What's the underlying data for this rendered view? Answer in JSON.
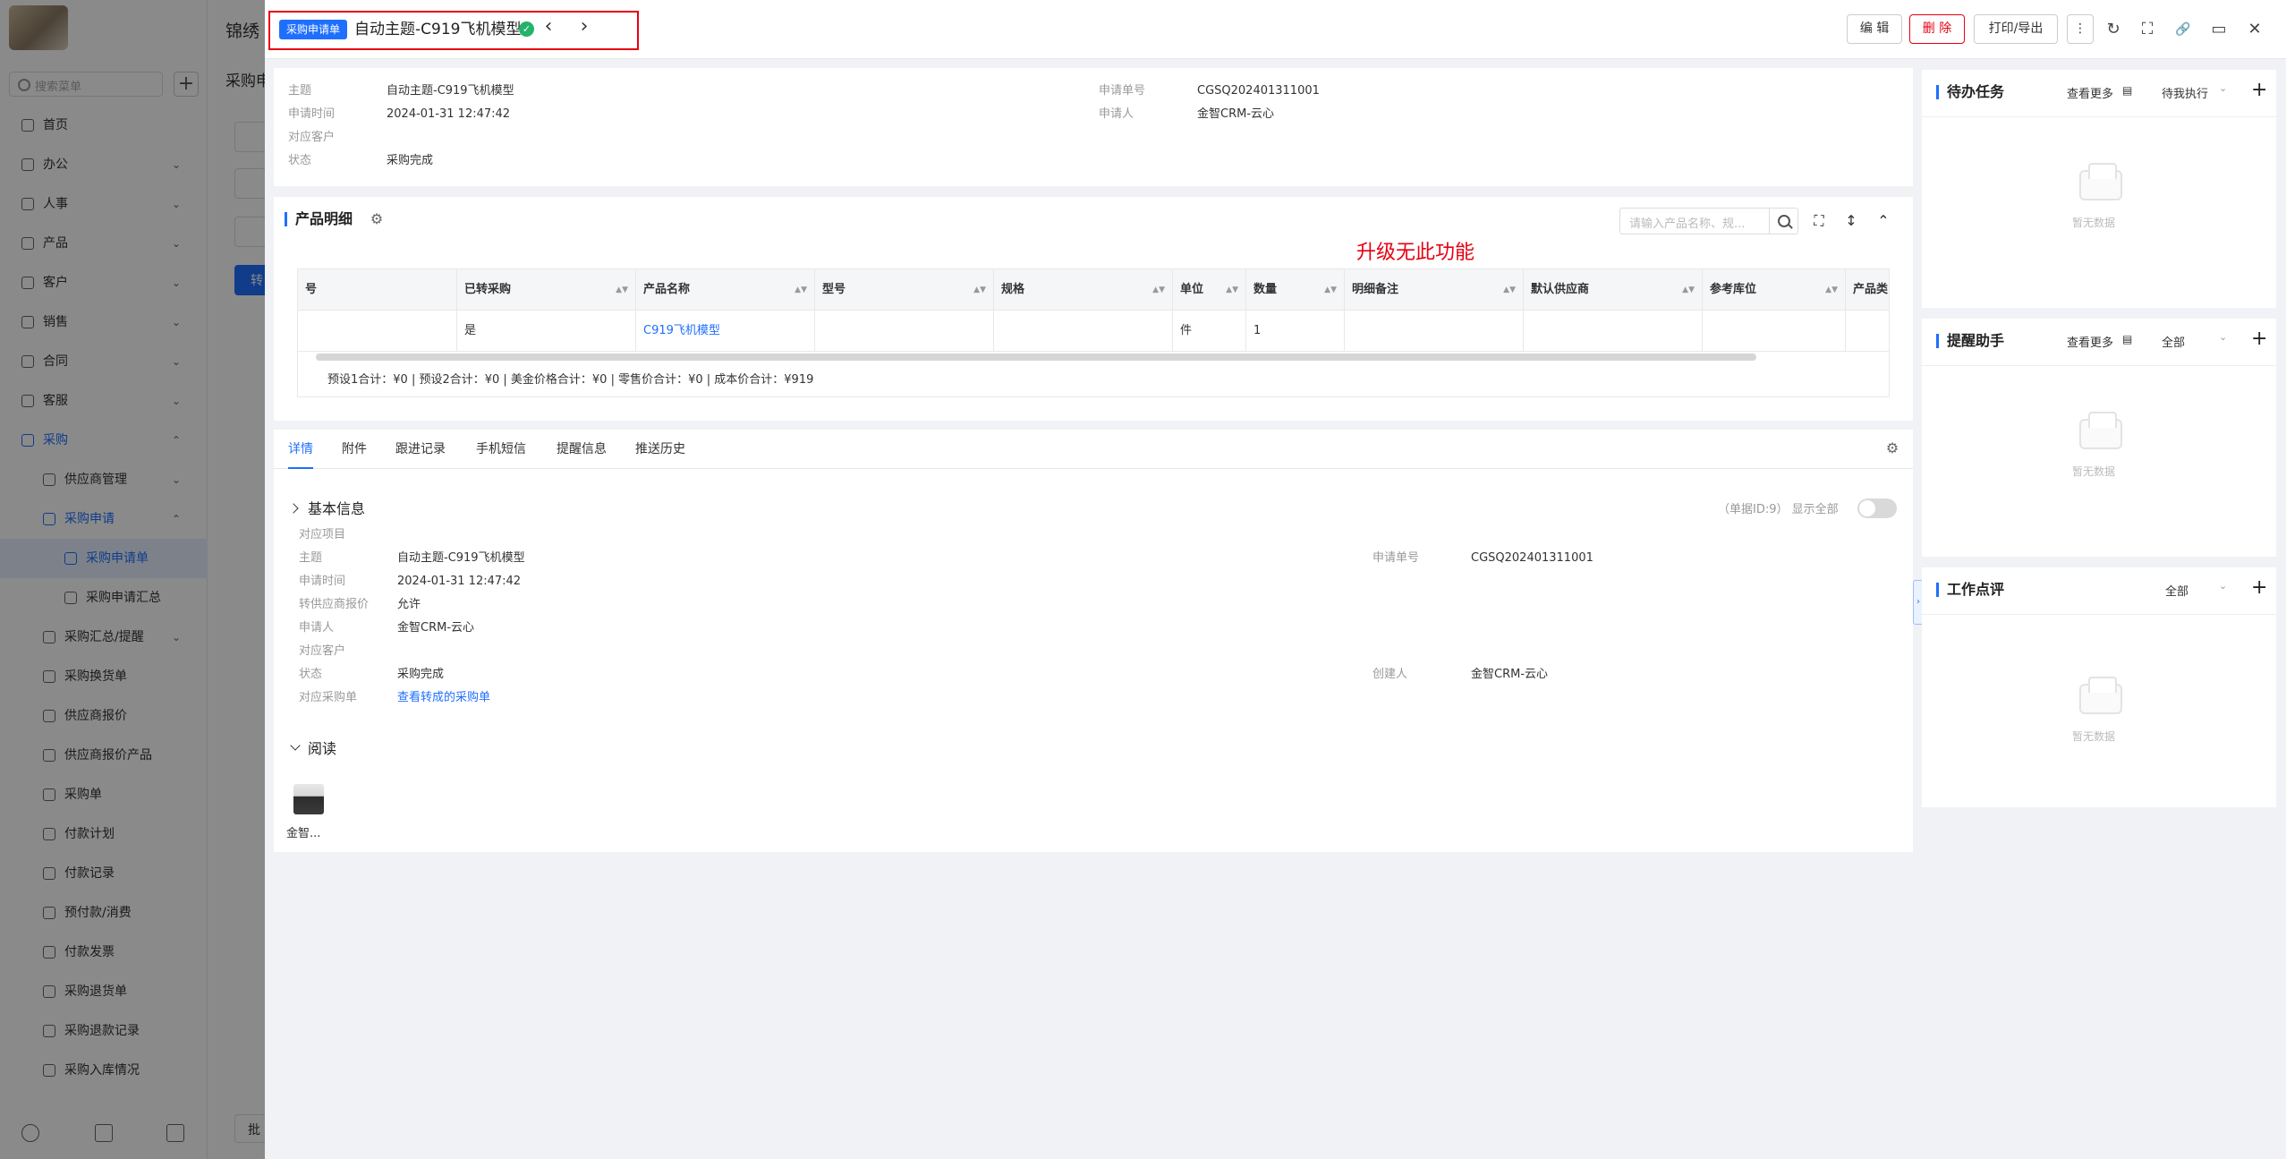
{
  "background": {
    "company": "锦绣",
    "search_placeholder": "搜索菜单",
    "page_title": "采购申",
    "primary_button": "转",
    "footer_button": "批",
    "menu": [
      {
        "label": "首页",
        "level": 0
      },
      {
        "label": "办公",
        "level": 0,
        "chev": "⌄"
      },
      {
        "label": "人事",
        "level": 0,
        "chev": "⌄"
      },
      {
        "label": "产品",
        "level": 0,
        "chev": "⌄"
      },
      {
        "label": "客户",
        "level": 0,
        "chev": "⌄"
      },
      {
        "label": "销售",
        "level": 0,
        "chev": "⌄"
      },
      {
        "label": "合同",
        "level": 0,
        "chev": "⌄"
      },
      {
        "label": "客服",
        "level": 0,
        "chev": "⌄"
      },
      {
        "label": "采购",
        "level": 0,
        "chev": "⌃",
        "active": true
      },
      {
        "label": "供应商管理",
        "level": 1,
        "chev": "⌄"
      },
      {
        "label": "采购申请",
        "level": 1,
        "chev": "⌃",
        "active": true
      },
      {
        "label": "采购申请单",
        "level": 2,
        "selected": true
      },
      {
        "label": "采购申请汇总",
        "level": 2
      },
      {
        "label": "采购汇总/提醒",
        "level": 1,
        "chev": "⌄"
      },
      {
        "label": "采购换货单",
        "level": 1
      },
      {
        "label": "供应商报价",
        "level": 1
      },
      {
        "label": "供应商报价产品",
        "level": 1
      },
      {
        "label": "采购单",
        "level": 1
      },
      {
        "label": "付款计划",
        "level": 1
      },
      {
        "label": "付款记录",
        "level": 1
      },
      {
        "label": "预付款/消费",
        "level": 1
      },
      {
        "label": "付款发票",
        "level": 1
      },
      {
        "label": "采购退货单",
        "level": 1
      },
      {
        "label": "采购退款记录",
        "level": 1
      },
      {
        "label": "采购入库情况",
        "level": 1
      }
    ]
  },
  "header": {
    "badge": "采购申请单",
    "title": "自动主题-C919飞机模型",
    "prev": "‹",
    "next": "›",
    "edit_label": "编 辑",
    "delete_label": "删 除",
    "print_label": "打印/导出",
    "more": "⋮",
    "refresh": "↻",
    "fullscreen": "⛶",
    "link": "🔗",
    "window": "▭",
    "close": "✕"
  },
  "summary": {
    "left": [
      {
        "k": "主题",
        "v": "自动主题-C919飞机模型"
      },
      {
        "k": "申请时间",
        "v": "2024-01-31 12:47:42"
      },
      {
        "k": "对应客户",
        "v": ""
      },
      {
        "k": "状态",
        "v": "采购完成"
      }
    ],
    "right": [
      {
        "k": "申请单号",
        "v": "CGSQ202401311001"
      },
      {
        "k": "申请人",
        "v": "金智CRM-云心"
      }
    ]
  },
  "products": {
    "title": "产品明细",
    "search_placeholder": "请输入产品名称、规...",
    "upgrade_note": "升级无此功能",
    "columns": [
      "号",
      "已转采购",
      "产品名称",
      "型号",
      "规格",
      "单位",
      "数量",
      "明细备注",
      "默认供应商",
      "参考库位",
      "产品类"
    ],
    "row": [
      "",
      "是",
      "C919飞机模型",
      "",
      "",
      "件",
      "1",
      "",
      "",
      "",
      ""
    ],
    "totals": "预设1合计：¥0 |   预设2合计：¥0 |   美金价格合计：¥0 |   零售价合计：¥0 |   成本价合计：¥919"
  },
  "detail": {
    "tabs": [
      "详情",
      "附件",
      "跟进记录",
      "手机短信",
      "提醒信息",
      "推送历史"
    ],
    "basic_title": "基本信息",
    "doc_meta": "（单据ID:9）   显示全部",
    "fields_left": [
      {
        "k": "对应项目",
        "v": ""
      },
      {
        "k": "主题",
        "v": "自动主题-C919飞机模型"
      },
      {
        "k": "申请时间",
        "v": "2024-01-31 12:47:42"
      },
      {
        "k": "转供应商报价",
        "v": "允许"
      },
      {
        "k": "申请人",
        "v": "金智CRM-云心"
      },
      {
        "k": "对应客户",
        "v": ""
      },
      {
        "k": "状态",
        "v": "采购完成"
      },
      {
        "k": "对应采购单",
        "v": "查看转成的采购单"
      }
    ],
    "fields_right": [
      {
        "k": "申请单号",
        "v": "CGSQ202401311001"
      },
      {
        "k": "创建人",
        "v": "金智CRM-云心"
      }
    ],
    "read_title": "阅读",
    "reader_name": "金智..."
  },
  "widgets": {
    "todo": {
      "title": "待办任务",
      "more": "查看更多",
      "filter": "待我执行",
      "empty": "暂无数据"
    },
    "reminder": {
      "title": "提醒助手",
      "more": "查看更多",
      "filter": "全部",
      "empty": "暂无数据"
    },
    "review": {
      "title": "工作点评",
      "filter": "全部",
      "empty": "暂无数据"
    }
  }
}
